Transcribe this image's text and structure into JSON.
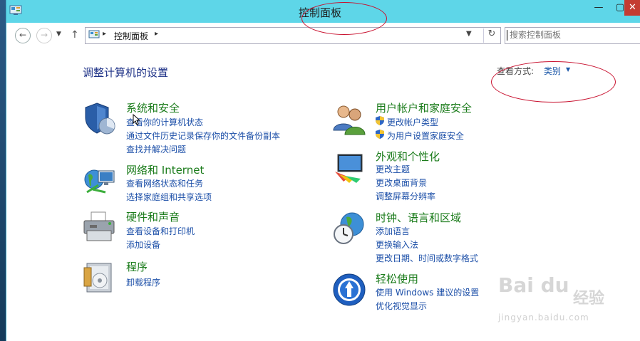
{
  "window": {
    "title": "控制面板",
    "minimize_icon": "minimize-icon",
    "maximize_icon": "maximize-icon",
    "close_icon": "close-icon"
  },
  "navbar": {
    "back_icon": "back-arrow-icon",
    "forward_icon": "forward-arrow-icon",
    "recent_icon": "chevron-down-icon",
    "up_icon": "up-arrow-icon",
    "address_sep": "▸",
    "address_text": "控制面板",
    "refresh_icon": "refresh-icon",
    "search_placeholder": "搜索控制面板"
  },
  "main": {
    "title": "调整计算机的设置",
    "viewby_label": "查看方式:",
    "viewby_value": "类别"
  },
  "categories_left": [
    {
      "heading": "系统和安全",
      "icon": "shield-chart-icon",
      "links": [
        "查看你的计算机状态",
        "通过文件历史记录保存你的文件备份副本",
        "查找并解决问题"
      ]
    },
    {
      "heading": "网络和 Internet",
      "icon": "network-globe-icon",
      "links": [
        "查看网络状态和任务",
        "选择家庭组和共享选项"
      ]
    },
    {
      "heading": "硬件和声音",
      "icon": "printer-icon",
      "links": [
        "查看设备和打印机",
        "添加设备"
      ]
    },
    {
      "heading": "程序",
      "icon": "programs-icon",
      "links": [
        "卸载程序"
      ]
    }
  ],
  "categories_right": [
    {
      "heading": "用户帐户和家庭安全",
      "icon": "users-icon",
      "links": [
        "更改帐户类型",
        "为用户设置家庭安全"
      ]
    },
    {
      "heading": "外观和个性化",
      "icon": "monitor-palette-icon",
      "links": [
        "更改主题",
        "更改桌面背景",
        "调整屏幕分辨率"
      ]
    },
    {
      "heading": "时钟、语言和区域",
      "icon": "clock-globe-icon",
      "links": [
        "添加语言",
        "更换输入法",
        "更改日期、时间或数字格式"
      ]
    },
    {
      "heading": "轻松使用",
      "icon": "ease-of-access-icon",
      "links": [
        "使用 Windows 建议的设置",
        "优化视觉显示"
      ]
    }
  ],
  "watermark": {
    "brand": "Bai du",
    "word": "经验",
    "url": "jingyan.baidu.com"
  },
  "colors": {
    "titlebar": "#5ed6e8",
    "heading_green": "#1a7b1a",
    "link_blue": "#1c4fa8",
    "annotation_red": "#c8102e"
  }
}
